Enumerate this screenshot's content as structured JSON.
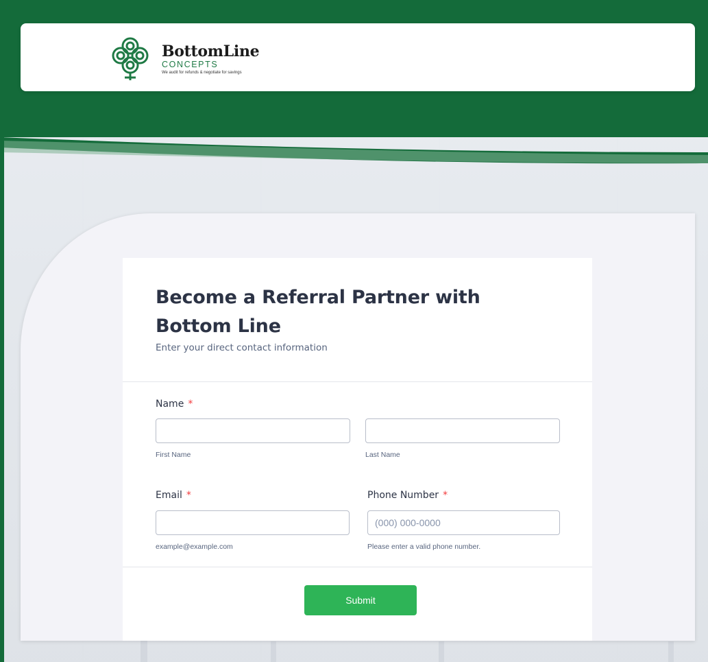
{
  "brand": {
    "name": "BottomLine",
    "sub": "CONCEPTS",
    "tagline": "We audit for refunds & negotiate for savings",
    "logo_icon": "celtic-knot-icon",
    "primary_color": "#146b3a",
    "accent_color": "#1f7a45"
  },
  "form": {
    "title": "Become a Referral Partner with Bottom Line",
    "subtitle": "Enter your direct contact information",
    "name": {
      "label": "Name",
      "required_mark": "*",
      "first_sublabel": "First Name",
      "last_sublabel": "Last Name",
      "first_value": "",
      "last_value": ""
    },
    "email": {
      "label": "Email",
      "required_mark": "*",
      "value": "",
      "sublabel": "example@example.com"
    },
    "phone": {
      "label": "Phone Number",
      "required_mark": "*",
      "value": "",
      "placeholder": "(000) 000-0000",
      "sublabel": "Please enter a valid phone number."
    },
    "submit_label": "Submit",
    "submit_color": "#2eb457"
  }
}
